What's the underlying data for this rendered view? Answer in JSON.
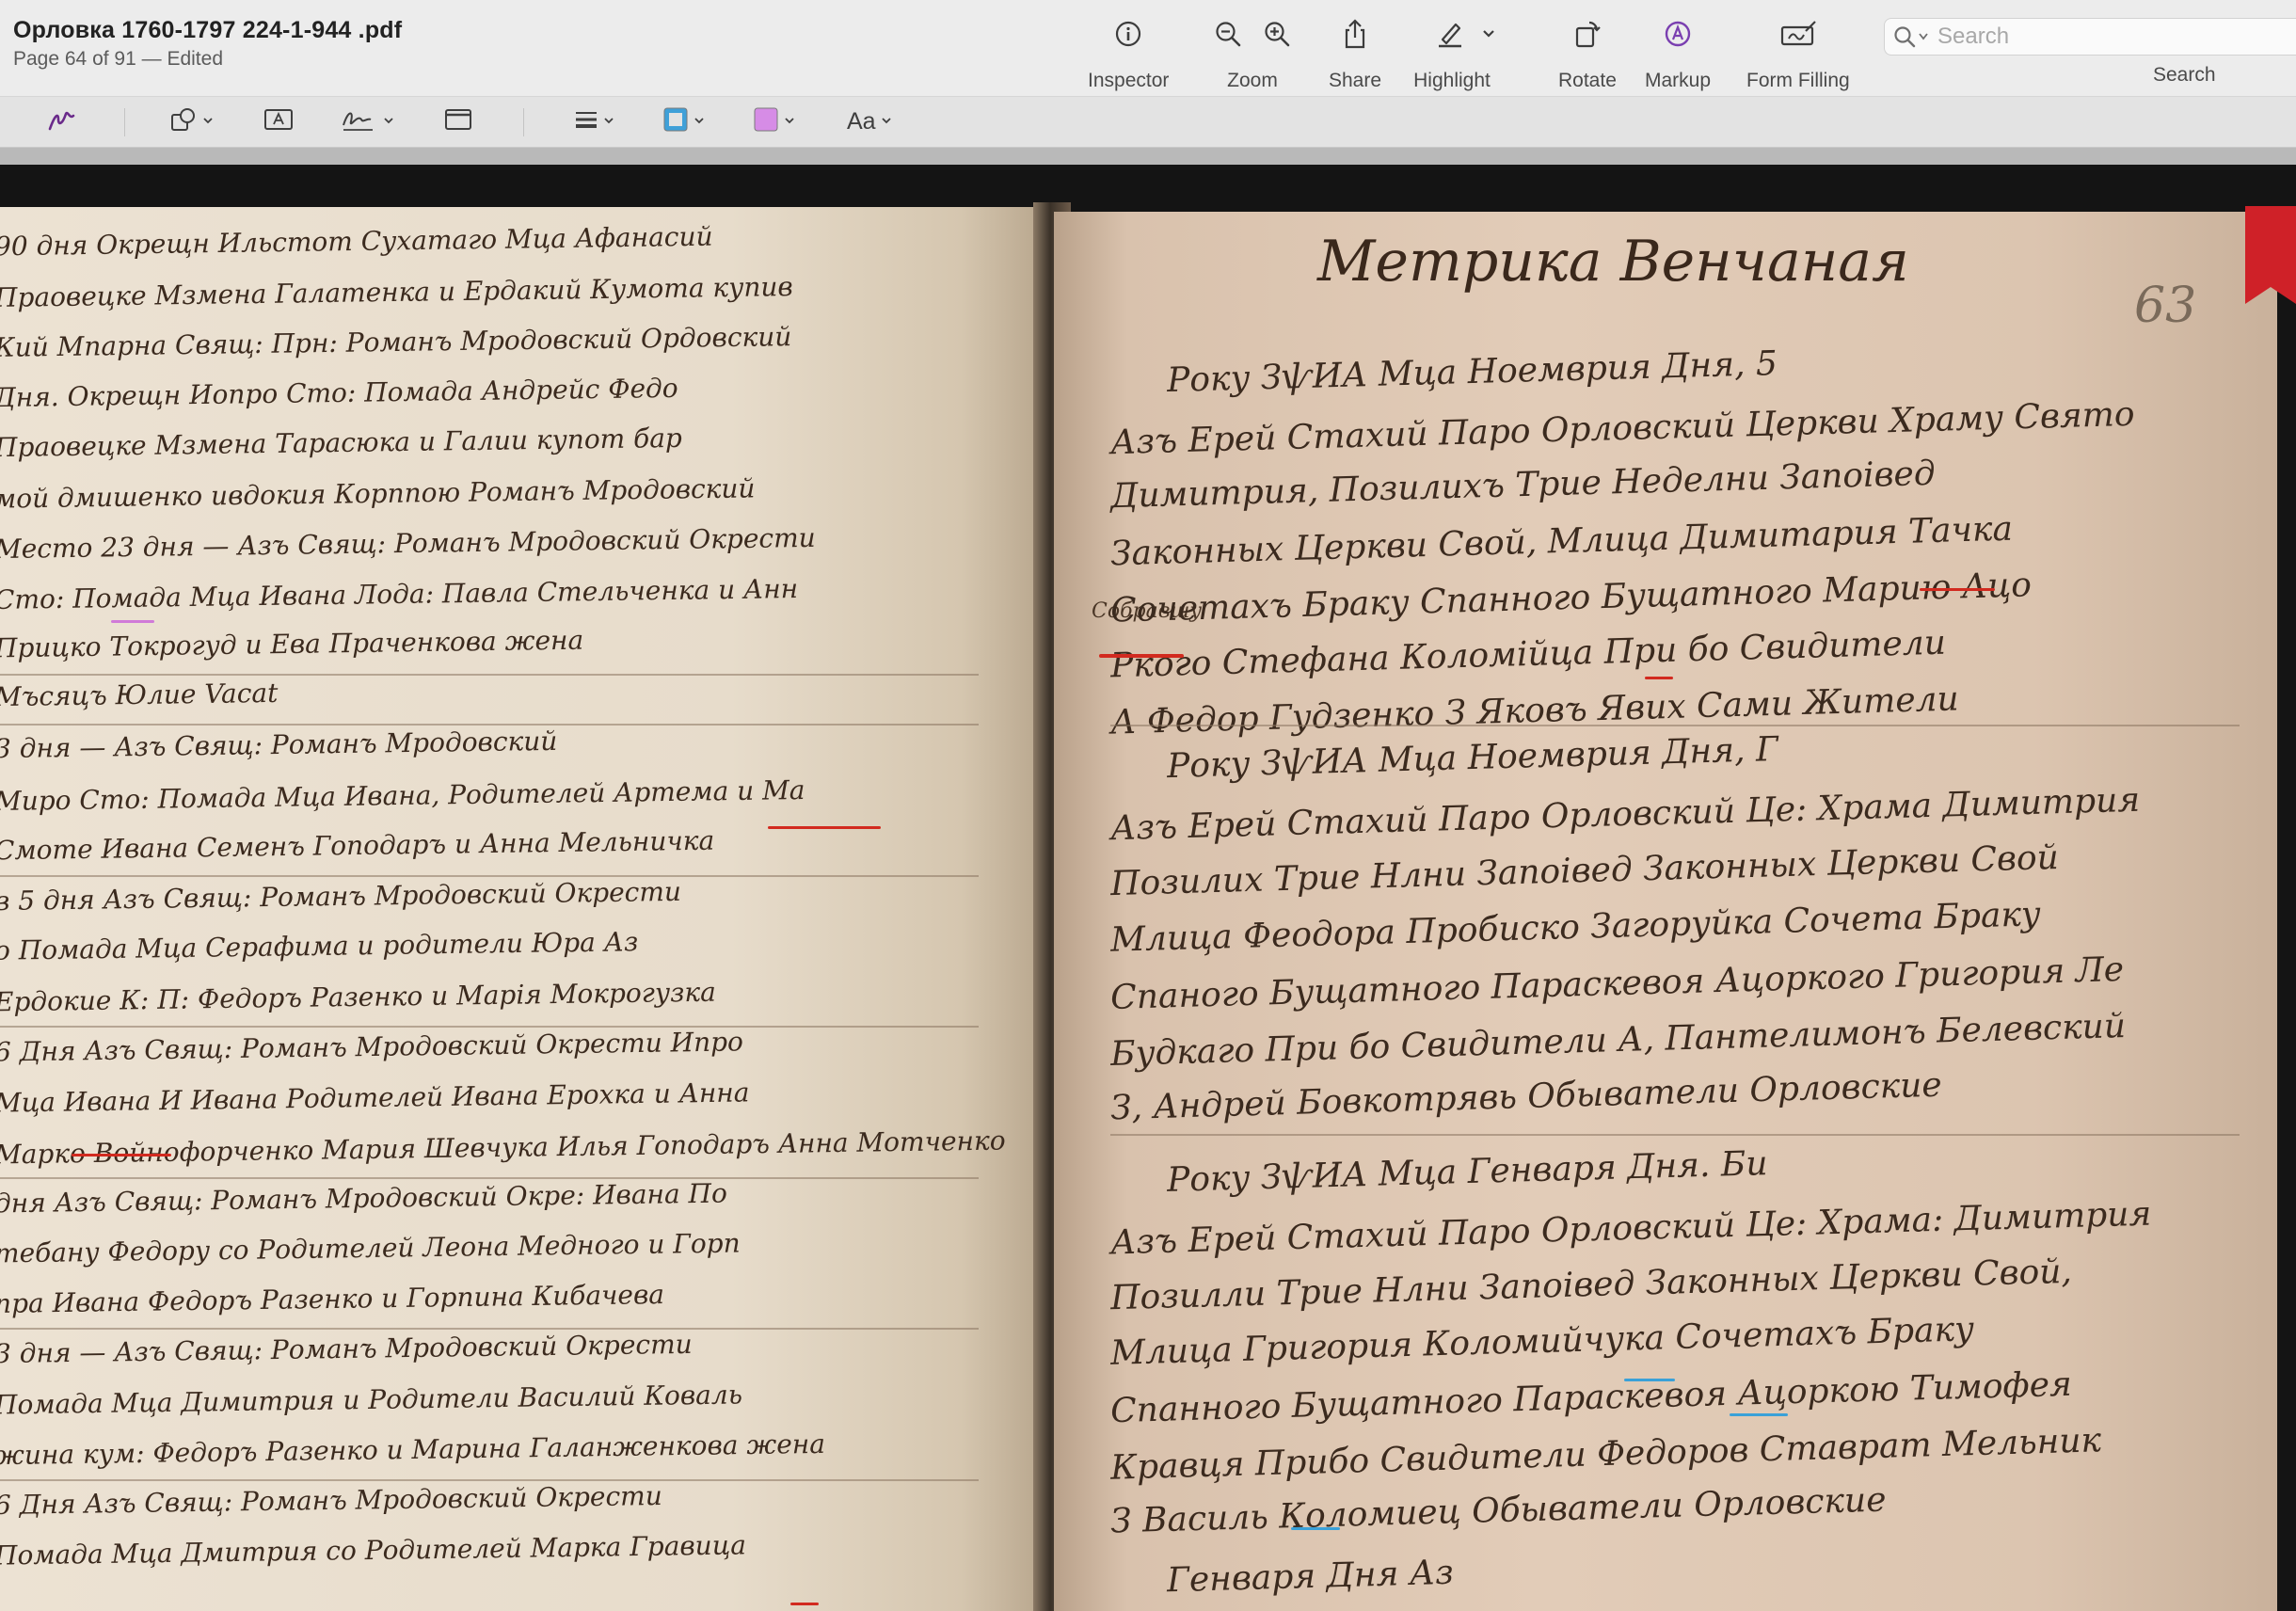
{
  "window": {
    "title": "Орловка 1760-1797 224-1-944 .pdf",
    "subtitle": "Page 64 of 91 — Edited"
  },
  "toolbar": {
    "inspector": "Inspector",
    "zoom": "Zoom",
    "share": "Share",
    "highlight": "Highlight",
    "rotate": "Rotate",
    "markup": "Markup",
    "form_filling": "Form Filling",
    "search_label": "Search",
    "search_placeholder": "Search"
  },
  "markup_bar": {
    "text_style": "Aa",
    "border_color": "#3fa0d8",
    "fill_color": "#d68ce6",
    "active_tool_color": "#6a2a8a"
  },
  "document": {
    "left_page_lines": [
      "90 дня Окрещн Ильстот Сухатаго Мца Афанасий",
      "Праовецке Мзмена Галатенка и Ердакий Кумота купив",
      "Кий Мпарна Свящ: Прн: Романъ Мродовский Ордовский",
      "Дня. Окрещн Иопро Сто: Помада Андрейс Федо",
      "Праовецке Мзмена Тарасюка и Галии купот бар",
      "мой дмишенко ивдокия Корппою Романъ Мродовский",
      "Место 23 дня — Азъ Свящ: Романъ Мродовский Окрести",
      "Сто: Помада Мца Ивана Лода: Павла Стельченка и Анн",
      "Прицко Токрогуд и Ева Праченкова жена",
      "Мъсяцъ Юлие Vacat",
      "3 дня — Азъ Свящ: Романъ Мродовский",
      "Миро Сто: Помада Мца Ивана, Родителей Артема и Ма",
      "Смоте Ивана Семенъ Гоподаръ и Анна Мельничка",
      "в 5 дня Азъ Свящ: Романъ Мродовский Окрести",
      "о Помада Мца Серафима и родители Юра Аз",
      "Ердокие К: П: Федоръ Разенко и Марія Мокрогузка",
      "6 Дня Азъ Свящ: Романъ Мродовский Окрести Ипро",
      "Мца Ивана И Ивана Родителей Ивана Ерохка и Анна",
      "Марко Войнофорченко Мария Шевчука Илья Гоподаръ Анна Мотченко",
      "дня Азъ Свящ: Романъ Мродовский Окре: Ивана По",
      "тебану Федору со Родителей Леона Медного и Горп",
      "пра Ивана Федоръ Разенко и Горпина Кибачева",
      "3 дня — Азъ Свящ: Романъ Мродовский Окрести",
      "Помада Мца Димитрия и Родители Василий Коваль",
      "жина кум: Федоръ Разенко и Марина Галанженкова жена",
      "6 Дня Азъ Свящ: Романъ Мродовский Окрести",
      "Помада Мца Дмитрия со Родителей Марка Гравица"
    ],
    "right_page_header": "Метрика Венчаная",
    "right_page_number": "63",
    "right_page_lines": [
      "Року ЗѱИА Мца Ноемврия Дня, 5",
      "Азъ Ерей Стахий Паро Орловский Церкви Храму Свято",
      "Димитрия, Позилихъ Трие Неделни Запоівед",
      "Законных Церкви Свой, Млица Димитария Тачка",
      "Сочетахъ Браку Спанного Бущатного Марию Ацо",
      "Ркого Стефана Коломійца При бо Свидители",
      "А Федор Гудзенко З Яковъ Явих Сами Жители",
      "Року ЗѱИА Мца Ноемврия Дня, Г",
      "Азъ Ерей Стахий Паро Орловский Це: Храма Димитрия",
      "Позилих Трие Нлни Запоівед Законных Церкви Свой",
      "Млица Феодора Пробиско Загоруйка Сочета Браку",
      "Спаного Бущатного Параскевоя Ацоркого Григория Ле",
      "Будкаго При бо Свидители А, Пантелимонъ Белевский",
      "З, Андрей Бовкотрявь Обыватели Орловские",
      "Року ЗѱИА Мца Генваря Дня. Би",
      "Азъ Ерей Стахий Паро Орловский Це: Храма: Димитрия",
      "Позилли Трие Нлни Запоівед Законных Церкви Свой,",
      "Млица Григория Коломийчука Сочетахъ Браку",
      "Спанного Бущатного Параскевоя Ацоркою Тимофея",
      "Кравця Прибо Свидители Федоров Ставрат Мельник",
      "З Василь Коломиец Обыватели Орловские",
      "Генваря Дня Аз"
    ],
    "margin_note": "Собравшу"
  }
}
